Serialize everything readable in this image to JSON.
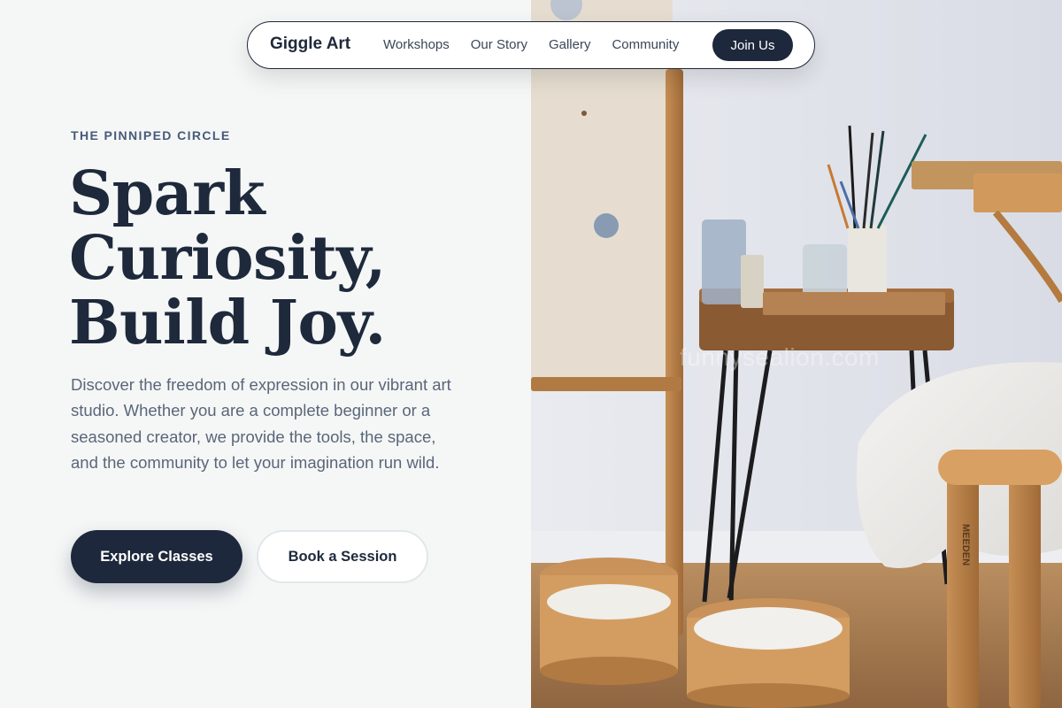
{
  "nav": {
    "logo": "Giggle Art",
    "links": [
      "Workshops",
      "Our Story",
      "Gallery",
      "Community"
    ],
    "cta": "Join Us"
  },
  "hero": {
    "eyebrow": "THE PINNIPED CIRCLE",
    "headline_lines": [
      "Spark",
      "Curiosity,",
      "Build Joy."
    ],
    "description": "Discover the freedom of expression in our vibrant art studio. Whether you are a complete beginner or a seasoned creator, we provide the tools, the space, and the community to let your imagination run wild.",
    "primary_button": "Explore Classes",
    "secondary_button": "Book a Session"
  },
  "photo": {
    "watermark": "funnysealion.com",
    "easel_text": "MEEDEN"
  },
  "colors": {
    "navy": "#1e283c",
    "page_bg": "#f5f7f7",
    "eyebrow": "#475a78",
    "body_text": "#5a6678"
  }
}
